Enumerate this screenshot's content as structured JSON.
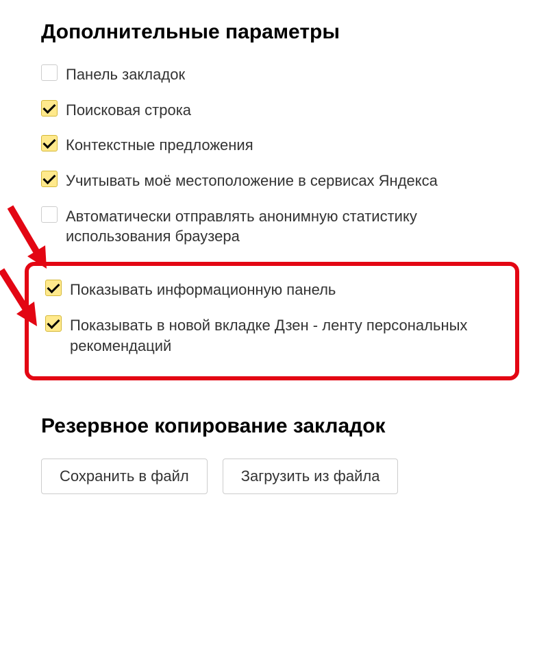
{
  "sections": {
    "advanced": {
      "title": "Дополнительные параметры",
      "options": {
        "bookmarks_bar": {
          "label": "Панель закладок",
          "checked": false
        },
        "search_bar": {
          "label": "Поисковая строка",
          "checked": true
        },
        "contextual": {
          "label": "Контекстные предложения",
          "checked": true
        },
        "location": {
          "label": "Учитывать моё местоположение в сервисах Яндекса",
          "checked": true
        },
        "anon_stats": {
          "label": "Автоматически отправлять анонимную статистику использования браузера",
          "checked": false
        },
        "info_panel": {
          "label": "Показывать информационную панель",
          "checked": true
        },
        "dzen_feed": {
          "label": "Показывать в новой вкладке Дзен - ленту персональных рекомендаций",
          "checked": true
        }
      }
    },
    "backup": {
      "title": "Резервное копирование закладок",
      "buttons": {
        "save": "Сохранить в файл",
        "load": "Загрузить из файла"
      }
    }
  }
}
